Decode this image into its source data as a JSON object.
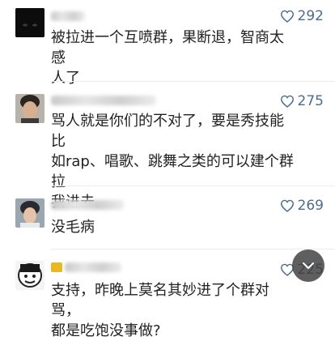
{
  "comments": [
    {
      "text": "被拉进一个互喷群，果断退，智商太感\n人了",
      "likes": "292"
    },
    {
      "text": "骂人就是你们的不对了，要是秀技能比\n如rap、唱歌、跳舞之类的可以建个群拉\n我进去。",
      "likes": "275"
    },
    {
      "text": "没毛病",
      "likes": "269"
    },
    {
      "text": "支持，昨晚上莫名其妙进了个群对骂，\n都是吃饱没事做?",
      "likes": "225"
    }
  ],
  "icons": {
    "like": "heart-outline-icon",
    "overlay": "chevron-down-icon"
  },
  "colors": {
    "like": "#4a6c8f",
    "text": "#222222"
  }
}
